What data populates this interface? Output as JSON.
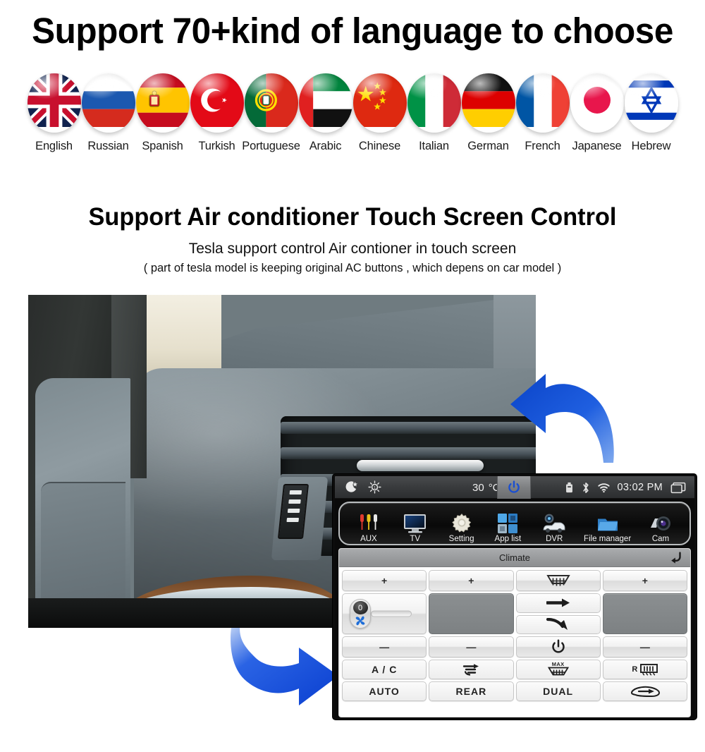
{
  "section_language": {
    "heading": "Support 70+kind of  language to choose",
    "flags": [
      {
        "label": "English",
        "icon": "flag-uk-icon"
      },
      {
        "label": "Russian",
        "icon": "flag-russia-icon"
      },
      {
        "label": "Spanish",
        "icon": "flag-spain-icon"
      },
      {
        "label": "Turkish",
        "icon": "flag-turkey-icon"
      },
      {
        "label": "Portuguese",
        "icon": "flag-portugal-icon"
      },
      {
        "label": "Arabic",
        "icon": "flag-uae-icon"
      },
      {
        "label": "Chinese",
        "icon": "flag-china-icon"
      },
      {
        "label": "Italian",
        "icon": "flag-italy-icon"
      },
      {
        "label": "German",
        "icon": "flag-germany-icon"
      },
      {
        "label": "French",
        "icon": "flag-france-icon"
      },
      {
        "label": "Japanese",
        "icon": "flag-japan-icon"
      },
      {
        "label": "Hebrew",
        "icon": "flag-israel-icon"
      }
    ]
  },
  "section_ac": {
    "heading": "Support Air conditioner Touch Screen Control",
    "subheading": "Tesla support control Air contioner in touch screen",
    "note": "( part of tesla model is keeping original AC buttons , which depens on car model )",
    "photo_caption": "car-dashboard-air-vent-photo",
    "arrow_top": "blue-curved-arrow-pointing-left",
    "arrow_bottom": "blue-curved-arrow-pointing-right"
  },
  "head_unit": {
    "status_bar": {
      "night_icon": "moon-star-icon",
      "brightness_icon": "brightness-sun-icon",
      "temperature_value": "30",
      "temperature_unit": "°C",
      "power_icon": "power-icon",
      "usb_icon": "usb-icon",
      "bluetooth_icon": "bluetooth-icon",
      "wifi_icon": "wifi-icon",
      "clock": "03:02 PM",
      "window_icon": "window-restore-icon"
    },
    "app_bar": [
      {
        "label": "AUX",
        "icon": "rca-plugs-icon"
      },
      {
        "label": "TV",
        "icon": "television-icon"
      },
      {
        "label": "Setting",
        "icon": "gear-icon"
      },
      {
        "label": "App list",
        "icon": "app-grid-icon"
      },
      {
        "label": "DVR",
        "icon": "dashcam-car-icon"
      },
      {
        "label": "File manager",
        "icon": "folder-icon"
      },
      {
        "label": "Cam",
        "icon": "camera-icon"
      }
    ],
    "climate": {
      "title": "Climate",
      "back_icon": "back-arrow-icon",
      "row_plus": [
        {
          "name": "driver-temp-up",
          "label": "+",
          "icon": "plus-icon"
        },
        {
          "name": "passenger-temp-up",
          "label": "+",
          "icon": "plus-icon"
        },
        {
          "name": "front-defrost",
          "label": "",
          "icon": "front-defrost-icon"
        },
        {
          "name": "fan-speed-up",
          "label": "+",
          "icon": "plus-icon"
        }
      ],
      "fan_slider": {
        "name": "fan-speed-slider",
        "value": "0",
        "icon": "fan-icon"
      },
      "driver_temp_display": "",
      "passenger_temp_display": "",
      "airflow_buttons": [
        {
          "name": "airflow-face",
          "icon": "arrow-right-icon"
        },
        {
          "name": "airflow-floor",
          "icon": "arrow-down-right-icon"
        }
      ],
      "seat_mode": {
        "name": "airflow-seated-person",
        "icon": "seated-person-airflow-icon"
      },
      "row_minus": [
        {
          "name": "driver-temp-down",
          "label": "—",
          "icon": "minus-icon"
        },
        {
          "name": "passenger-temp-down",
          "label": "—",
          "icon": "minus-icon"
        },
        {
          "name": "climate-power",
          "label": "",
          "icon": "power-icon"
        },
        {
          "name": "fan-speed-down",
          "label": "—",
          "icon": "minus-icon"
        }
      ],
      "row_func": [
        {
          "name": "ac-button",
          "label": "A / C",
          "icon": ""
        },
        {
          "name": "recirculate-button",
          "label": "",
          "icon": "recirculate-airflow-icon"
        },
        {
          "name": "max-defrost-button",
          "label": "MAX",
          "icon": "max-defrost-icon"
        },
        {
          "name": "rear-defrost-button",
          "label": "R",
          "icon": "rear-defrost-icon"
        }
      ],
      "row_mode": [
        {
          "name": "auto-button",
          "label": "AUTO",
          "icon": ""
        },
        {
          "name": "rear-button",
          "label": "REAR",
          "icon": ""
        },
        {
          "name": "dual-button",
          "label": "DUAL",
          "icon": ""
        },
        {
          "name": "air-recirculation-button",
          "label": "",
          "icon": "car-recirculation-icon"
        }
      ]
    }
  },
  "colors": {
    "accent_blue": "#1153e0",
    "background": "#ffffff",
    "text": "#111111",
    "bezel": "#0a0a0a",
    "statusbar": "#3a3c3e",
    "climate_header": "#9a9c9e",
    "blank_button": "#82868a"
  }
}
